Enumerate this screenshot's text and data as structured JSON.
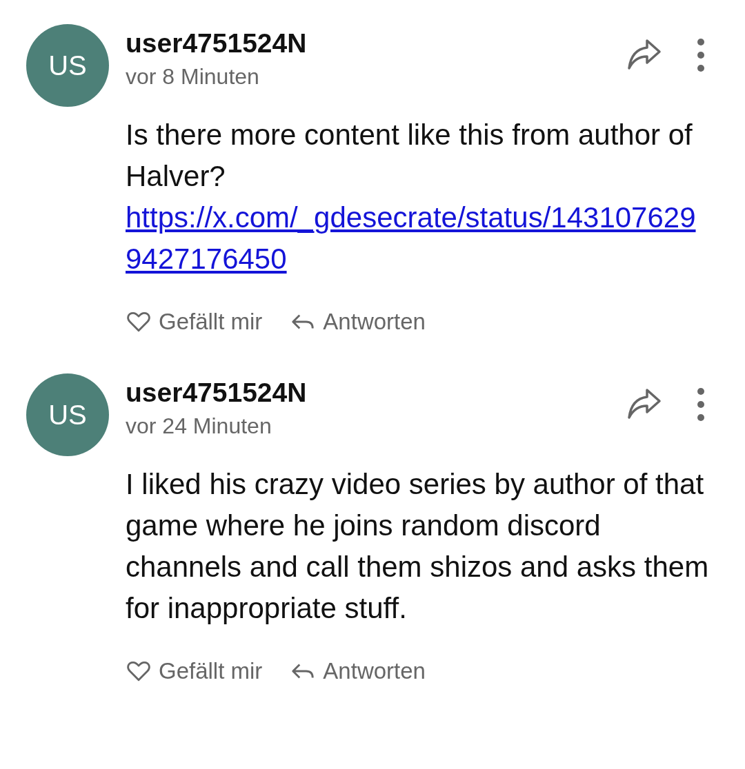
{
  "comments": [
    {
      "avatar": "US",
      "author": "user4751524N",
      "time": "vor 8 Minuten",
      "text": "Is there more content like this from author of Halver?",
      "link": "https://x.com/_gdesecrate/status/1431076299427176450",
      "like": "Gefällt mir",
      "reply": "Antworten"
    },
    {
      "avatar": "US",
      "author": "user4751524N",
      "time": "vor 24 Minuten",
      "text": "I liked his crazy video series by author of that game where he joins random discord channels and call them shizos and asks them for inappropriate stuff.",
      "like": "Gefällt mir",
      "reply": "Antworten"
    }
  ]
}
